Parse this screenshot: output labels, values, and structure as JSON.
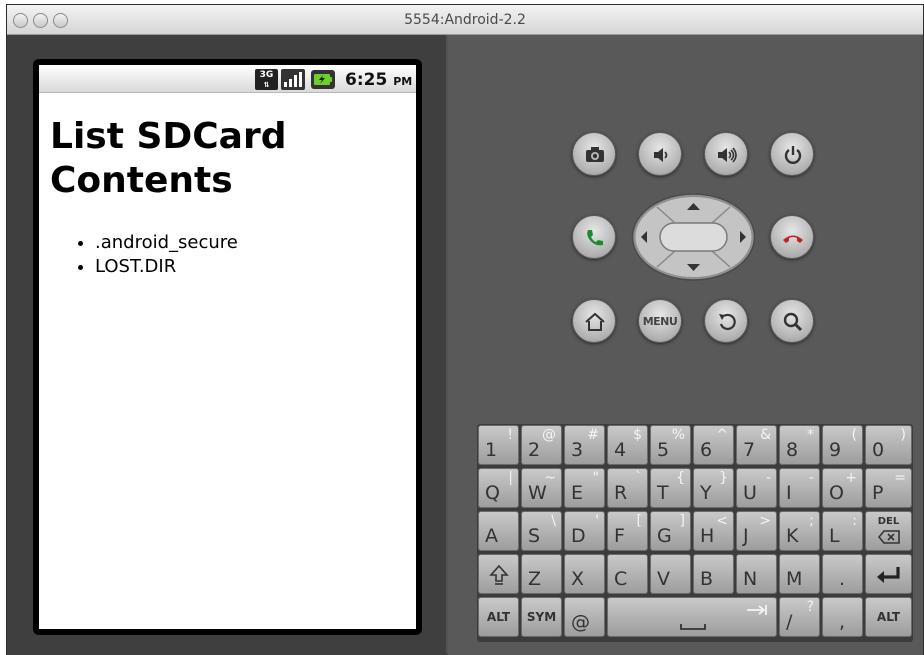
{
  "window": {
    "title": "5554:Android-2.2"
  },
  "status_bar": {
    "network_badge": "3G",
    "time": "6:25",
    "ampm": "PM"
  },
  "page": {
    "heading": "List SDCard Contents",
    "files": [
      ".android_secure",
      "LOST.DIR"
    ]
  },
  "controls": {
    "menu_label": "MENU"
  },
  "keyboard": {
    "row1": [
      {
        "main": "1",
        "alt": "!"
      },
      {
        "main": "2",
        "alt": "@"
      },
      {
        "main": "3",
        "alt": "#"
      },
      {
        "main": "4",
        "alt": "$"
      },
      {
        "main": "5",
        "alt": "%"
      },
      {
        "main": "6",
        "alt": "^"
      },
      {
        "main": "7",
        "alt": "&"
      },
      {
        "main": "8",
        "alt": "*"
      },
      {
        "main": "9",
        "alt": "("
      },
      {
        "main": "0",
        "alt": ")"
      }
    ],
    "row2": [
      {
        "main": "Q",
        "alt": "|"
      },
      {
        "main": "W",
        "alt": "~"
      },
      {
        "main": "E",
        "alt": "\""
      },
      {
        "main": "R",
        "alt": "`"
      },
      {
        "main": "T",
        "alt": "{"
      },
      {
        "main": "Y",
        "alt": "}"
      },
      {
        "main": "U",
        "alt": "-"
      },
      {
        "main": "I",
        "alt": "-"
      },
      {
        "main": "O",
        "alt": "+"
      },
      {
        "main": "P",
        "alt": "="
      }
    ],
    "row3": [
      {
        "main": "A",
        "alt": ""
      },
      {
        "main": "S",
        "alt": "\\"
      },
      {
        "main": "D",
        "alt": "'"
      },
      {
        "main": "F",
        "alt": "["
      },
      {
        "main": "G",
        "alt": "]"
      },
      {
        "main": "H",
        "alt": "<"
      },
      {
        "main": "J",
        "alt": ">"
      },
      {
        "main": "K",
        "alt": ";"
      },
      {
        "main": "L",
        "alt": ":"
      }
    ],
    "del_label": "DEL",
    "row4": [
      {
        "main": "Z",
        "alt": ""
      },
      {
        "main": "X",
        "alt": ""
      },
      {
        "main": "C",
        "alt": ""
      },
      {
        "main": "V",
        "alt": ""
      },
      {
        "main": "B",
        "alt": ""
      },
      {
        "main": "N",
        "alt": ""
      },
      {
        "main": "M",
        "alt": ""
      },
      {
        "main": ".",
        "alt": ""
      }
    ],
    "alt_label": "ALT",
    "sym_label": "SYM",
    "at_label": "@",
    "slash_key": {
      "main": "/",
      "alt": "?"
    },
    "comma_label": ","
  }
}
